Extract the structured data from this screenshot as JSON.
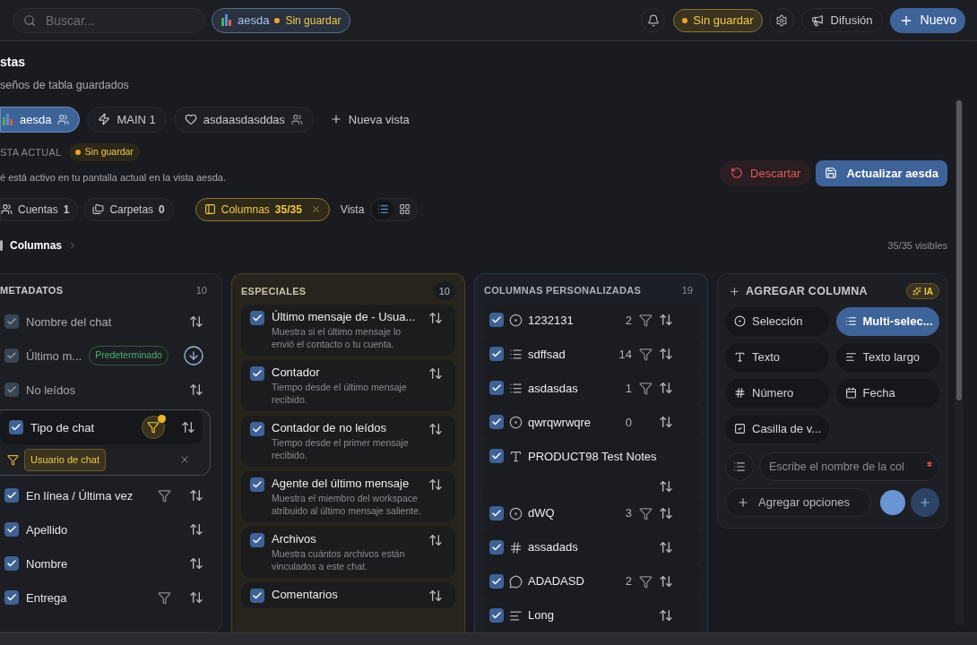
{
  "topbar": {
    "search_placeholder": "Buscar...",
    "view_chip": {
      "name": "aesda",
      "status": "Sin guardar"
    },
    "status_badge": "Sin guardar",
    "broadcast": "Difusión",
    "new_button": "Nuevo"
  },
  "views": {
    "title": "stas",
    "subtitle": "seños de tabla guardados",
    "tabs": [
      {
        "label": "aesda",
        "shared": true,
        "selected": true
      },
      {
        "label": "MAIN 1",
        "shared": false,
        "selected": false
      },
      {
        "label": "asdaasdasddas",
        "shared": true,
        "selected": false
      }
    ],
    "new_view": "Nueva vista"
  },
  "current_view": {
    "label": "STA ACTUAL",
    "status": "Sin guardar",
    "description": "é está activo en tu pantalla actual en la vista aesda.",
    "discard": "Descartar",
    "update": "Actualizar aesda"
  },
  "filters": [
    {
      "label": "Cuentas",
      "count": "1",
      "active": false
    },
    {
      "label": "Carpetas",
      "count": "0",
      "active": false
    },
    {
      "label": "Columnas",
      "count": "35/35",
      "active": true
    }
  ],
  "view_label": "Vista",
  "view_modes": [
    {
      "kind": "list",
      "selected": true
    },
    {
      "kind": "grid",
      "selected": false
    }
  ],
  "section": {
    "title": "Columnas",
    "visible": "35/35 visibles"
  },
  "metadata": {
    "title": "METADATOS",
    "count": "10",
    "rows": [
      {
        "label": "Nombre del chat",
        "checked": true,
        "disabled": true,
        "filter": false,
        "filter_active": false,
        "sorted": false
      },
      {
        "label": "Último m...",
        "checked": true,
        "disabled": true,
        "filter": false,
        "filter_active": false,
        "sorted": true,
        "badge": "Predeterminado"
      },
      {
        "label": "No leídos",
        "checked": true,
        "disabled": true,
        "filter": false,
        "filter_active": false,
        "sorted": false
      },
      {
        "label": "Tipo de chat",
        "checked": true,
        "disabled": false,
        "filter": true,
        "filter_active": true,
        "sorted": false,
        "filter_value": "Usuario de chat"
      },
      {
        "label": "En línea / Última vez",
        "checked": true,
        "disabled": false,
        "filter": true,
        "filter_active": false,
        "sorted": false
      },
      {
        "label": "Apellido",
        "checked": true,
        "disabled": false,
        "filter": false,
        "filter_active": false,
        "sorted": false
      },
      {
        "label": "Nombre",
        "checked": true,
        "disabled": false,
        "filter": false,
        "filter_active": false,
        "sorted": false
      },
      {
        "label": "Entrega",
        "checked": true,
        "disabled": false,
        "filter": true,
        "filter_active": false,
        "sorted": false
      }
    ]
  },
  "special": {
    "title": "ESPECIALES",
    "count": "10",
    "rows": [
      {
        "title": "Último mensaje de - Usua...",
        "description": "Muestra si el último mensaje lo envió el contacto o tu cuenta.",
        "checked": true
      },
      {
        "title": "Contador",
        "description": "Tiempo desde el último mensaje recibido.",
        "checked": true
      },
      {
        "title": "Contador de no leídos",
        "description": "Tiempo desde el primer mensaje recibido.",
        "checked": true
      },
      {
        "title": "Agente del último mensaje",
        "description": "Muestra el miembro del workspace atribuido al último mensaje saliente.",
        "checked": true
      },
      {
        "title": "Archivos",
        "description": "Muestra cuántos archivos están vinculados a este chat.",
        "checked": true
      },
      {
        "title": "Comentarios",
        "checked": true
      }
    ]
  },
  "custom": {
    "title": "COLUMNAS PERSONALIZADAS",
    "count": "19",
    "rows": [
      {
        "kind": "select",
        "label": "1232131",
        "count": "2",
        "filter": true,
        "checked": true
      },
      {
        "kind": "multi",
        "label": "sdffsad",
        "count": "14",
        "filter": true,
        "checked": true
      },
      {
        "kind": "multi",
        "label": "asdasdas",
        "count": "1",
        "filter": true,
        "checked": true
      },
      {
        "kind": "select",
        "label": "qwrqwrwqre",
        "count": "0",
        "filter": false,
        "checked": true
      },
      {
        "kind": "text",
        "label": "PRODUCT98 Test Notes",
        "filter": false,
        "checked": true
      },
      {
        "kind": "select",
        "label": "dWQ",
        "count": "3",
        "filter": true,
        "checked": true
      },
      {
        "kind": "number",
        "label": "assadads",
        "filter": false,
        "checked": true
      },
      {
        "kind": "comment",
        "label": "ADADASD",
        "count": "2",
        "filter": true,
        "checked": true
      },
      {
        "kind": "longtext",
        "label": "Long",
        "filter": false,
        "checked": true
      }
    ]
  },
  "add_column": {
    "title": "AGREGAR COLUMNA",
    "ai_badge": "IA",
    "types": [
      {
        "kind": "select",
        "label": "Selección",
        "selected": false
      },
      {
        "kind": "multi",
        "label": "Multi-selec...",
        "selected": true
      },
      {
        "kind": "text",
        "label": "Texto",
        "selected": false
      },
      {
        "kind": "longtext",
        "label": "Texto largo",
        "selected": false
      },
      {
        "kind": "number",
        "label": "Número",
        "selected": false
      },
      {
        "kind": "date",
        "label": "Fecha",
        "selected": false
      },
      {
        "kind": "checkbox",
        "label": "Casilla de v...",
        "selected": false
      }
    ],
    "name_placeholder": "Escribe el nombre de la col",
    "required": true,
    "add_options": "Agregar opciones",
    "color": "#6a95d4"
  }
}
